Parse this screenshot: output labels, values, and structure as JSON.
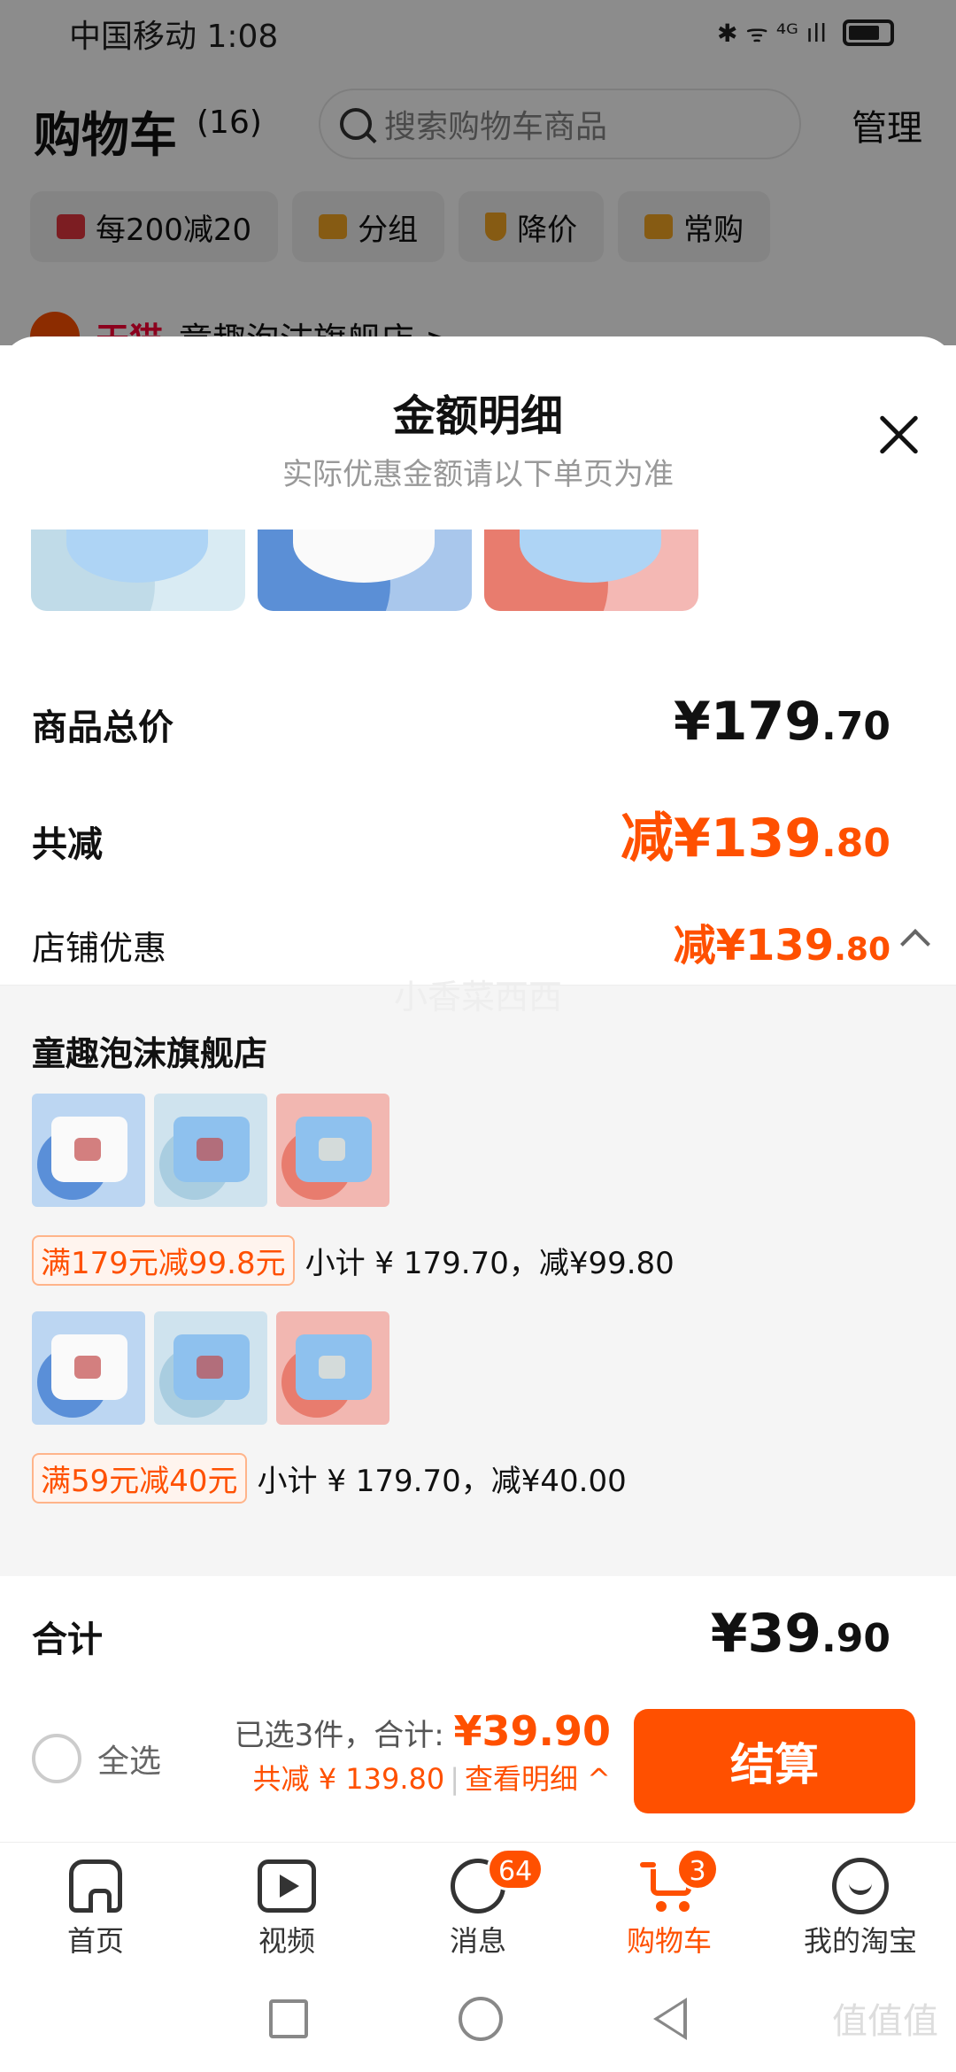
{
  "status_bar": {
    "carrier_time": "中国移动 1:08",
    "icons": "✱ ᯤ ⁴ᴳ ıll"
  },
  "cart": {
    "title": "购物车",
    "count": "(16)",
    "search_placeholder": "搜索购物车商品",
    "manage": "管理",
    "chips": [
      {
        "label": "每200减20",
        "icon": "shop-icon",
        "color": "#e2353e"
      },
      {
        "label": "分组",
        "icon": "folder-icon",
        "color": "#f5a623"
      },
      {
        "label": "降价",
        "icon": "arrow-down-icon",
        "color": "#f5a623"
      },
      {
        "label": "常购",
        "icon": "cart-icon",
        "color": "#f5a623"
      }
    ],
    "store_tag": "天猫",
    "store_name": "童趣泡沫旗舰店 >"
  },
  "sheet": {
    "title": "金额明细",
    "subtitle": "实际优惠金额请以下单页为准",
    "goods_total_label": "商品总价",
    "goods_total_int": "¥179",
    "goods_total_dec": ".70",
    "discount_label": "共减",
    "discount_int": "减¥139",
    "discount_dec": ".80",
    "store_discount_label": "店铺优惠",
    "store_discount_int": "减¥139",
    "store_discount_dec": ".80",
    "watermark": "小香菜西西",
    "panel": {
      "store_name": "童趣泡沫旗舰店",
      "groups": [
        {
          "promo": "满179元减99.8元",
          "subtotal": "小计 ¥ 179.70，减¥99.80"
        },
        {
          "promo": "满59元减40元",
          "subtotal": "小计 ¥ 179.70，减¥40.00"
        }
      ]
    },
    "total_label": "合计",
    "total_int": "¥39",
    "total_dec": ".90"
  },
  "checkout": {
    "select_all": "全选",
    "selected_text": "已选3件，合计: ",
    "sum": "¥39.90",
    "saved": "共减 ¥ 139.80",
    "view_detail": "查看明细 ^",
    "button": "结算"
  },
  "tabbar": [
    {
      "label": "首页",
      "icon": "home-icon"
    },
    {
      "label": "视频",
      "icon": "video-icon"
    },
    {
      "label": "消息",
      "icon": "message-icon",
      "badge": "64"
    },
    {
      "label": "购物车",
      "icon": "cart-icon",
      "badge": "3",
      "active": true
    },
    {
      "label": "我的淘宝",
      "icon": "smile-icon"
    }
  ],
  "watermark_site": "值值值",
  "colors": {
    "accent": "#ff5000",
    "tmall": "#ff0036"
  }
}
